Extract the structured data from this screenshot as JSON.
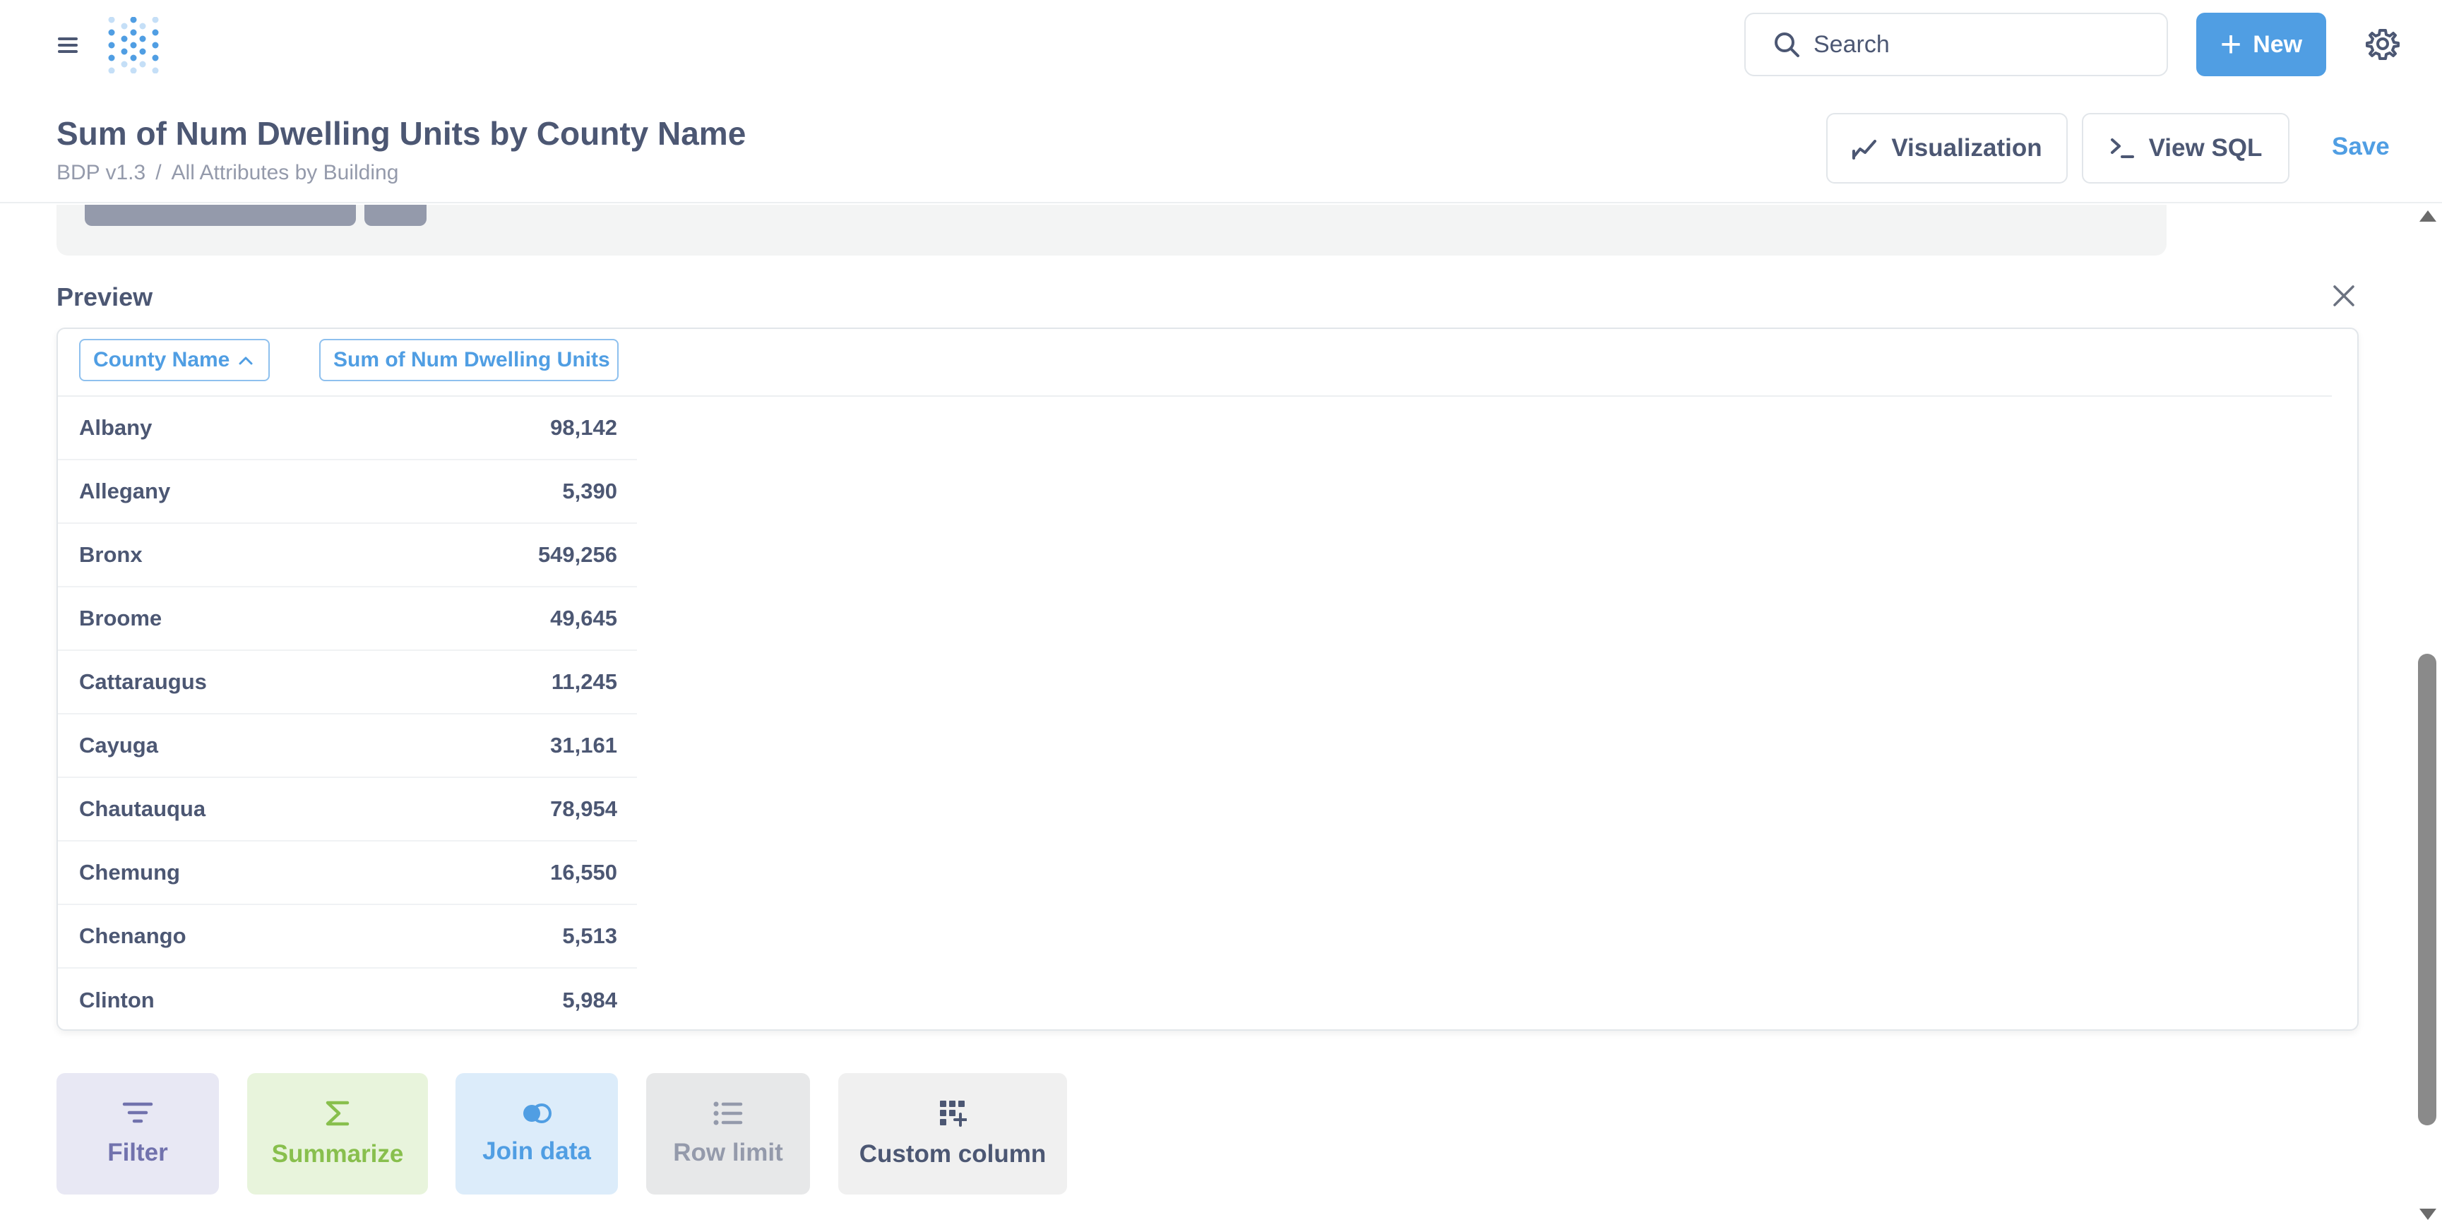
{
  "nav": {
    "search_placeholder": "Search",
    "new_label": "New",
    "new_icon": "plus-icon"
  },
  "question": {
    "title": "Sum of Num Dwelling Units by County Name",
    "breadcrumb": {
      "database": "BDP v1.3",
      "separator": "/",
      "table": "All Attributes by Building"
    },
    "buttons": {
      "visualization": "Visualization",
      "view_sql": "View SQL",
      "save": "Save"
    }
  },
  "preview": {
    "label": "Preview",
    "columns": [
      "County Name",
      "Sum of Num Dwelling Units"
    ],
    "sort_indicator": "^",
    "rows": [
      {
        "county": "Albany",
        "value": "98,142"
      },
      {
        "county": "Allegany",
        "value": "5,390"
      },
      {
        "county": "Bronx",
        "value": "549,256"
      },
      {
        "county": "Broome",
        "value": "49,645"
      },
      {
        "county": "Cattaraugus",
        "value": "11,245"
      },
      {
        "county": "Cayuga",
        "value": "31,161"
      },
      {
        "county": "Chautauqua",
        "value": "78,954"
      },
      {
        "county": "Chemung",
        "value": "16,550"
      },
      {
        "county": "Chenango",
        "value": "5,513"
      },
      {
        "county": "Clinton",
        "value": "5,984"
      }
    ]
  },
  "actions": [
    {
      "label": "Filter",
      "icon": "filter-icon",
      "color": "#7172ad"
    },
    {
      "label": "Summarize",
      "icon": "sigma-icon",
      "color": "#88bf4d"
    },
    {
      "label": "Join data",
      "icon": "join-icon",
      "color": "#509ee3"
    },
    {
      "label": "Row limit",
      "icon": "list-icon",
      "color": "#949aab"
    },
    {
      "label": "Custom column",
      "icon": "add-grid-icon",
      "color": "#4c5773"
    }
  ],
  "colors": {
    "brand": "#509ee3",
    "text": "#4c5773",
    "muted": "#949aab"
  }
}
